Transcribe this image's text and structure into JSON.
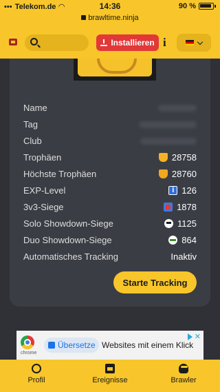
{
  "status_bar": {
    "carrier": "Telekom.de",
    "time": "14:36",
    "battery": "90 %",
    "url": "brawltime.ninja"
  },
  "header": {
    "search_placeholder": "",
    "install_label": "Installieren",
    "info_label": "i",
    "language": "de"
  },
  "stats": [
    {
      "label": "Name",
      "value": ""
    },
    {
      "label": "Tag",
      "value": ""
    },
    {
      "label": "Club",
      "value": ""
    },
    {
      "label": "Trophäen",
      "value": "28758",
      "icon": "trophy-icon"
    },
    {
      "label": "Höchste Trophäen",
      "value": "28760",
      "icon": "trophy-icon"
    },
    {
      "label": "EXP-Level",
      "value": "126",
      "icon": "level-icon"
    },
    {
      "label": "3v3-Siege",
      "value": "1878",
      "icon": "3v3-icon"
    },
    {
      "label": "Solo Showdown-Siege",
      "value": "1125",
      "icon": "skull-icon"
    },
    {
      "label": "Duo Showdown-Siege",
      "value": "864",
      "icon": "duo-showdown-icon"
    },
    {
      "label": "Automatisches Tracking",
      "value": "Inaktiv"
    }
  ],
  "track_button": "Starte Tracking",
  "ad": {
    "chrome_label": "chrome",
    "translate_label": "Übersetze",
    "text": "Websites mit einem Klick"
  },
  "nav": {
    "profile": "Profil",
    "events": "Ereignisse",
    "brawler": "Brawler"
  },
  "colors": {
    "accent": "#f8c62a",
    "install": "#e23838",
    "card": "#3b3d44",
    "background": "#2f3136"
  }
}
